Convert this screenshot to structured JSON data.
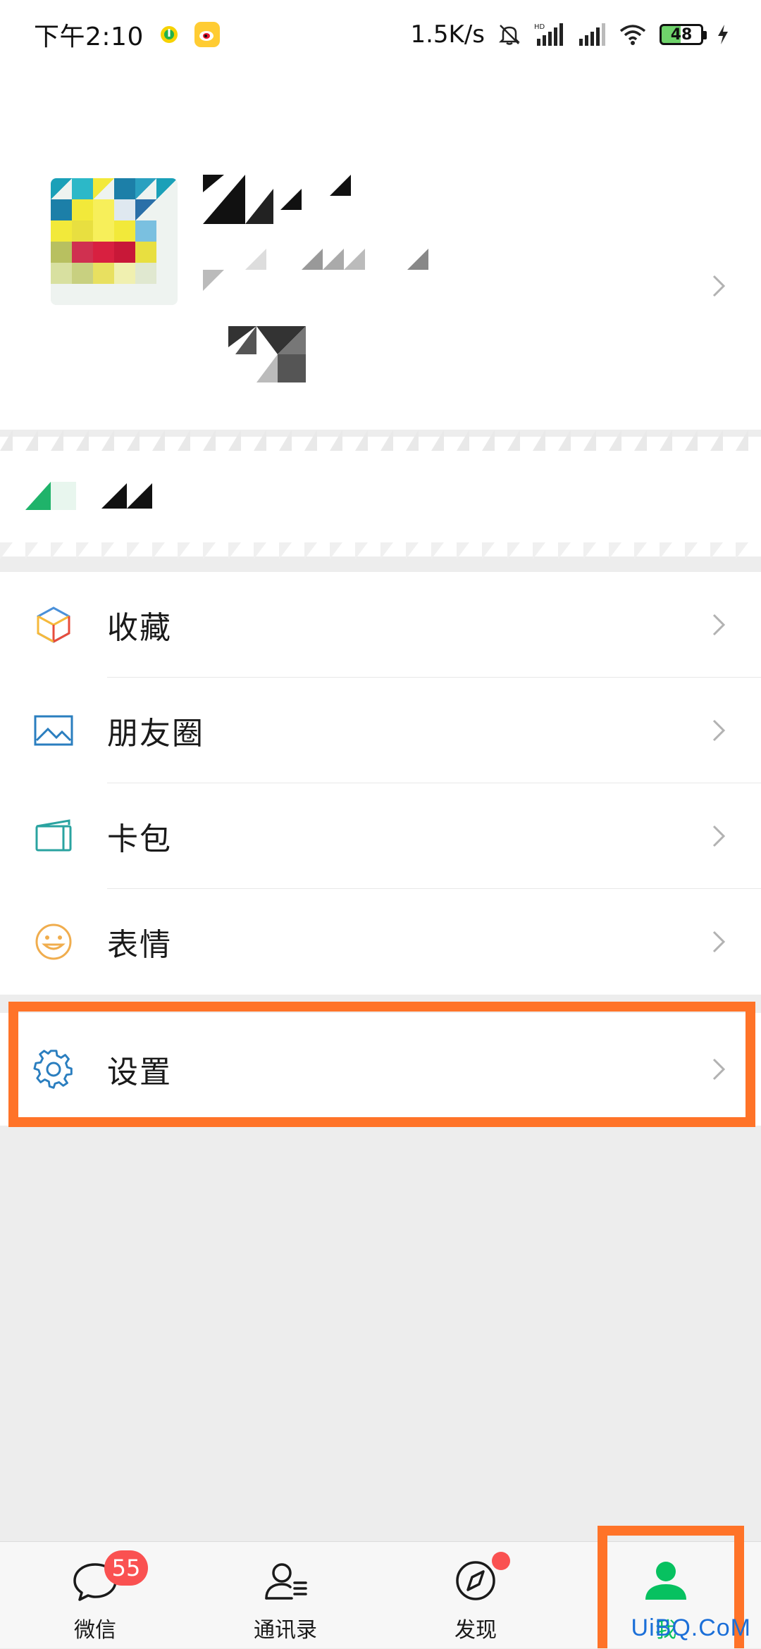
{
  "status_bar": {
    "time": "下午2:10",
    "network_speed": "1.5K/s",
    "battery_level": "48",
    "icons": [
      "qq-music-icon",
      "weibo-icon",
      "bell-muted-icon",
      "hd-signal-icon",
      "signal-icon",
      "wifi-icon",
      "battery-icon",
      "charging-icon"
    ]
  },
  "profile": {
    "chevron_icon": "chevron-right-icon"
  },
  "menu": {
    "group_1": [
      {
        "label": "收藏",
        "icon": "favorites-cube-icon"
      },
      {
        "label": "朋友圈",
        "icon": "moments-picture-icon"
      },
      {
        "label": "卡包",
        "icon": "card-wallet-icon"
      },
      {
        "label": "表情",
        "icon": "sticker-smile-icon"
      }
    ],
    "group_2": [
      {
        "label": "设置",
        "icon": "gear-icon"
      }
    ]
  },
  "tabbar": {
    "tabs": [
      {
        "label": "微信",
        "icon": "chat-bubble-icon",
        "badge": "55"
      },
      {
        "label": "通讯录",
        "icon": "contacts-icon"
      },
      {
        "label": "发现",
        "icon": "compass-icon"
      },
      {
        "label": "我",
        "icon": "me-person-icon"
      }
    ],
    "active_index": 3
  },
  "colors": {
    "accent_green": "#07c160",
    "highlight_orange": "#ff7328",
    "badge_red": "#fa5151",
    "background": "#ededed"
  },
  "watermark": "UiBQ.CoM"
}
